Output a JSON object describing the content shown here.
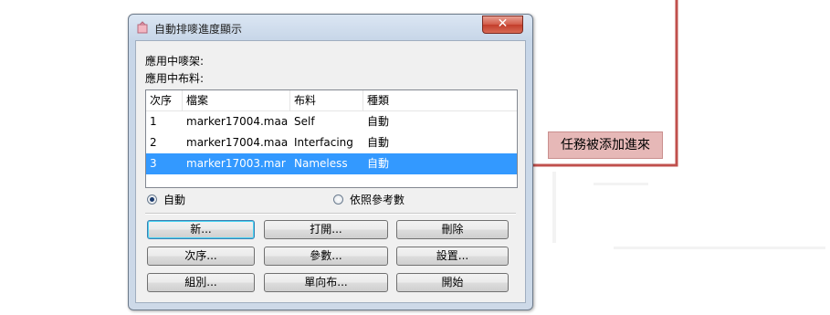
{
  "window": {
    "title": "自動排嘜進度顯示",
    "close_label": "✕"
  },
  "info": {
    "current_marker": "應用中嘜架:",
    "current_fabric": "應用中布料:"
  },
  "list": {
    "columns": [
      "次序",
      "檔案",
      "布料",
      "種類"
    ],
    "rows": [
      {
        "order": "1",
        "file": "marker17004.maa",
        "fabric": "Self",
        "type": "自動"
      },
      {
        "order": "2",
        "file": "marker17004.maa",
        "fabric": "Interfacing",
        "type": "自動"
      },
      {
        "order": "3",
        "file": "marker17003.mar",
        "fabric": "Nameless",
        "type": "自動"
      }
    ],
    "selected_row": 3
  },
  "mode": {
    "auto_label": "自動",
    "auto_checked": true,
    "by_param_label": "依照參考數",
    "by_param_checked": false
  },
  "buttons": {
    "new": "新...",
    "open": "打開...",
    "delete": "刪除",
    "order": "次序...",
    "params": "參數...",
    "settings": "設置...",
    "group": "組別...",
    "single_direction": "單向布...",
    "start": "開始"
  },
  "annotation": {
    "text": "任務被添加進來",
    "color": "#c0504d",
    "fill": "#e6b8b7"
  }
}
